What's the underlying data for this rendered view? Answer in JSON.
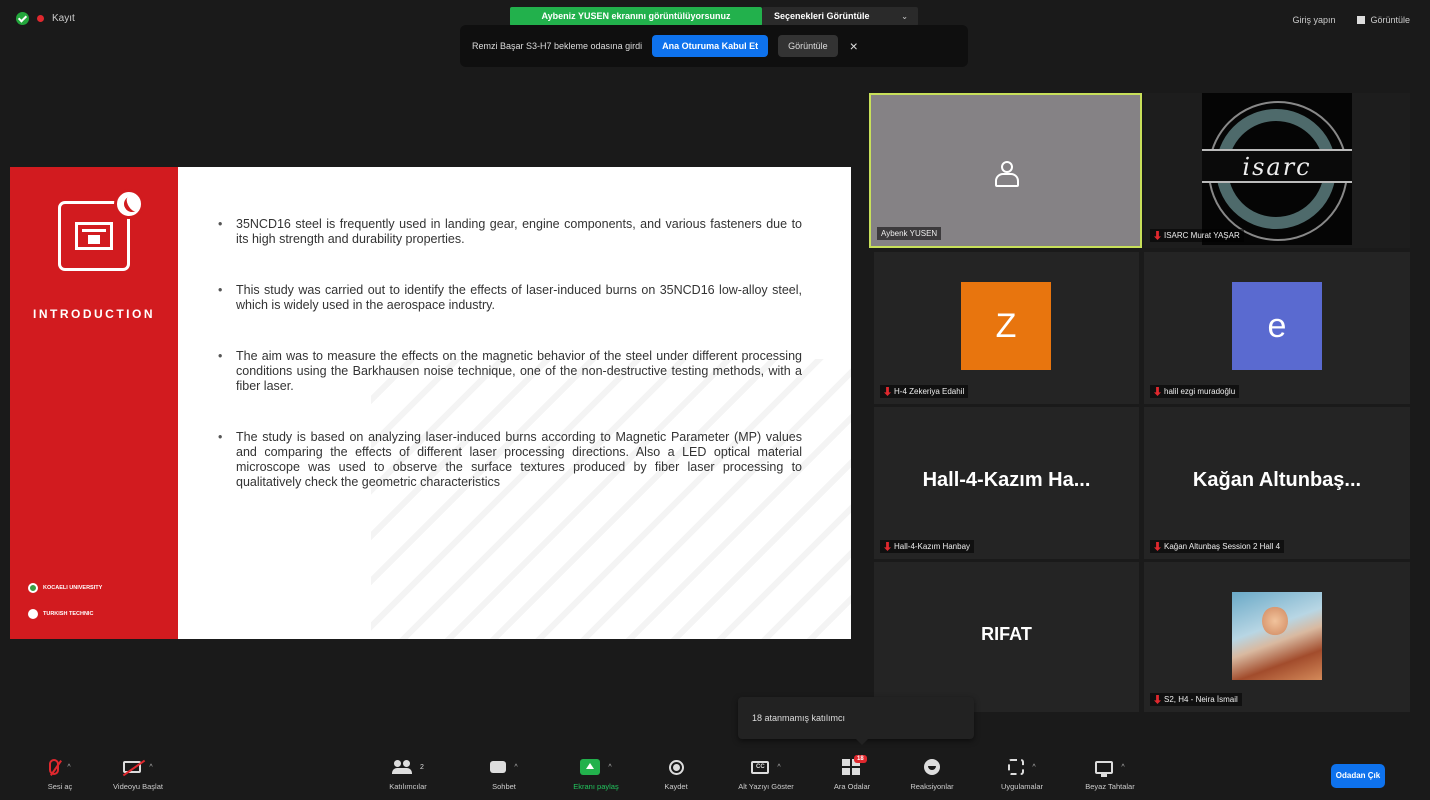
{
  "top": {
    "record_label": "Kayıt",
    "share_banner": "Aybeniz YUSEN ekranını görüntülüyorsunuz",
    "view_options_label": "Seçenekleri Görüntüle",
    "sign_in_label": "Giriş yapın",
    "view_label": "Görüntüle"
  },
  "notification": {
    "message": "Remzi Başar S3-H7 bekleme odasına girdi",
    "accept_label": "Ana Oturuma Kabul Et",
    "view_label": "Görüntüle",
    "close_symbol": "×"
  },
  "slide": {
    "section_title": "INTRODUCTION",
    "partners": [
      "KOCAELI UNIVERSITY",
      "TURKISH TECHNIC"
    ],
    "bullets": [
      "35NCD16 steel is frequently used in landing gear, engine components, and various fasteners due to its high strength and durability properties.",
      "This study was carried out to identify the effects of laser-induced burns on 35NCD16 low-alloy steel, which is widely used in the aerospace industry.",
      "The aim was to measure the effects on the magnetic behavior of the steel under different processing conditions using the Barkhausen noise technique, one of the non-destructive testing methods, with a fiber laser.",
      "The study is based on analyzing laser-induced burns according to Magnetic Parameter (MP) values and comparing the effects of different laser processing directions. Also a LED optical material microscope was used to observe the surface textures produced by fiber laser processing to qualitatively check the geometric characteristics"
    ]
  },
  "gallery": {
    "tiles": [
      {
        "name": "Aybenk YUSEN"
      },
      {
        "name": "ISARC Murat YAŞAR",
        "logo_text": "isarc"
      },
      {
        "name": "H-4 Zekeriya Edahil",
        "avatar_letter": "Z",
        "avatar_color": "#e8750e"
      },
      {
        "name": "halil ezgi muradoğlu",
        "avatar_letter": "e",
        "avatar_color": "#5a6ad0"
      },
      {
        "name": "Hall-4-Kazım Hanbay",
        "display": "Hall-4-Kazım  Ha..."
      },
      {
        "name": "Kağan Altunbaş Session 2 Hall 4",
        "display": "Kağan  Altunbaş..."
      },
      {
        "display": "RIFAT"
      },
      {
        "name": "S2, H4 - Neira İsmail"
      }
    ]
  },
  "tooltip": "18 atanmamış katılımcı",
  "toolbar": {
    "items": [
      {
        "label": "Sesi aç"
      },
      {
        "label": "Videoyu Başlat"
      },
      {
        "label": "Katılımcılar",
        "count": "2"
      },
      {
        "label": "Sohbet"
      },
      {
        "label": "Ekranı paylaş"
      },
      {
        "label": "Kaydet"
      },
      {
        "label": "Alt Yazıyı Göster",
        "cc": "CC"
      },
      {
        "label": "Ara Odalar",
        "badge": "18"
      },
      {
        "label": "Reaksiyonlar"
      },
      {
        "label": "Uygulamalar"
      },
      {
        "label": "Beyaz Tahtalar"
      }
    ],
    "leave_label": "Odadan Çık"
  },
  "colors": {
    "accent_blue": "#0e72ed",
    "share_green": "#22b14c",
    "slide_red": "#d21b1f",
    "active_speaker": "#c8e05a"
  },
  "icons": [
    "shield-check-icon",
    "record-dot-icon",
    "chevron-down-icon",
    "close-icon",
    "mic-muted-icon",
    "video-off-icon",
    "participants-icon",
    "chat-icon",
    "share-screen-icon",
    "record-icon",
    "captions-icon",
    "breakout-rooms-icon",
    "reactions-icon",
    "apps-icon",
    "whiteboard-icon"
  ]
}
